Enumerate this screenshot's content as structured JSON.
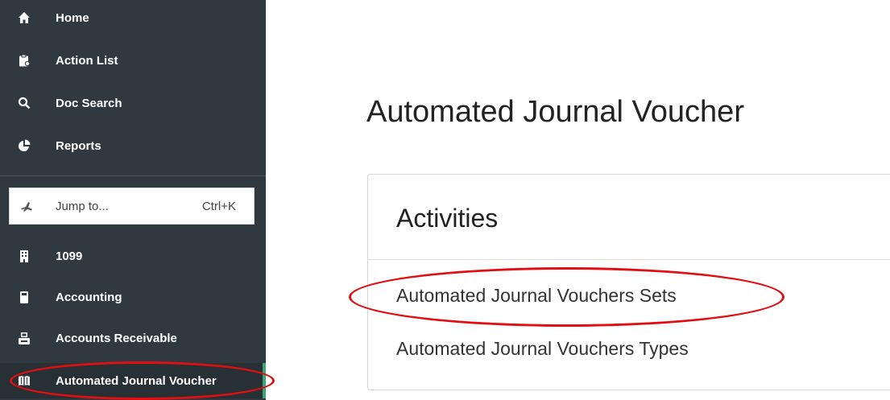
{
  "sidebar": {
    "items": [
      {
        "label": "Home",
        "icon": "home-icon"
      },
      {
        "label": "Action List",
        "icon": "clipboard-icon"
      },
      {
        "label": "Doc Search",
        "icon": "search-icon"
      },
      {
        "label": "Reports",
        "icon": "pie-chart-icon"
      }
    ],
    "jump": {
      "label": "Jump to...",
      "shortcut": "Ctrl+K",
      "icon": "plane-icon"
    },
    "modules": [
      {
        "label": "1099",
        "icon": "building-icon"
      },
      {
        "label": "Accounting",
        "icon": "calculator-icon"
      },
      {
        "label": "Accounts Receivable",
        "icon": "register-icon"
      },
      {
        "label": "Automated Journal Voucher",
        "icon": "book-icon"
      }
    ],
    "colors": {
      "background": "#30393f",
      "active_indicator": "#3fa37a"
    }
  },
  "main": {
    "title": "Automated Journal Voucher",
    "card": {
      "title": "Activities",
      "links": [
        "Automated Journal Vouchers Sets",
        "Automated Journal Vouchers Types"
      ]
    }
  },
  "annotation_color": "#e10f12"
}
